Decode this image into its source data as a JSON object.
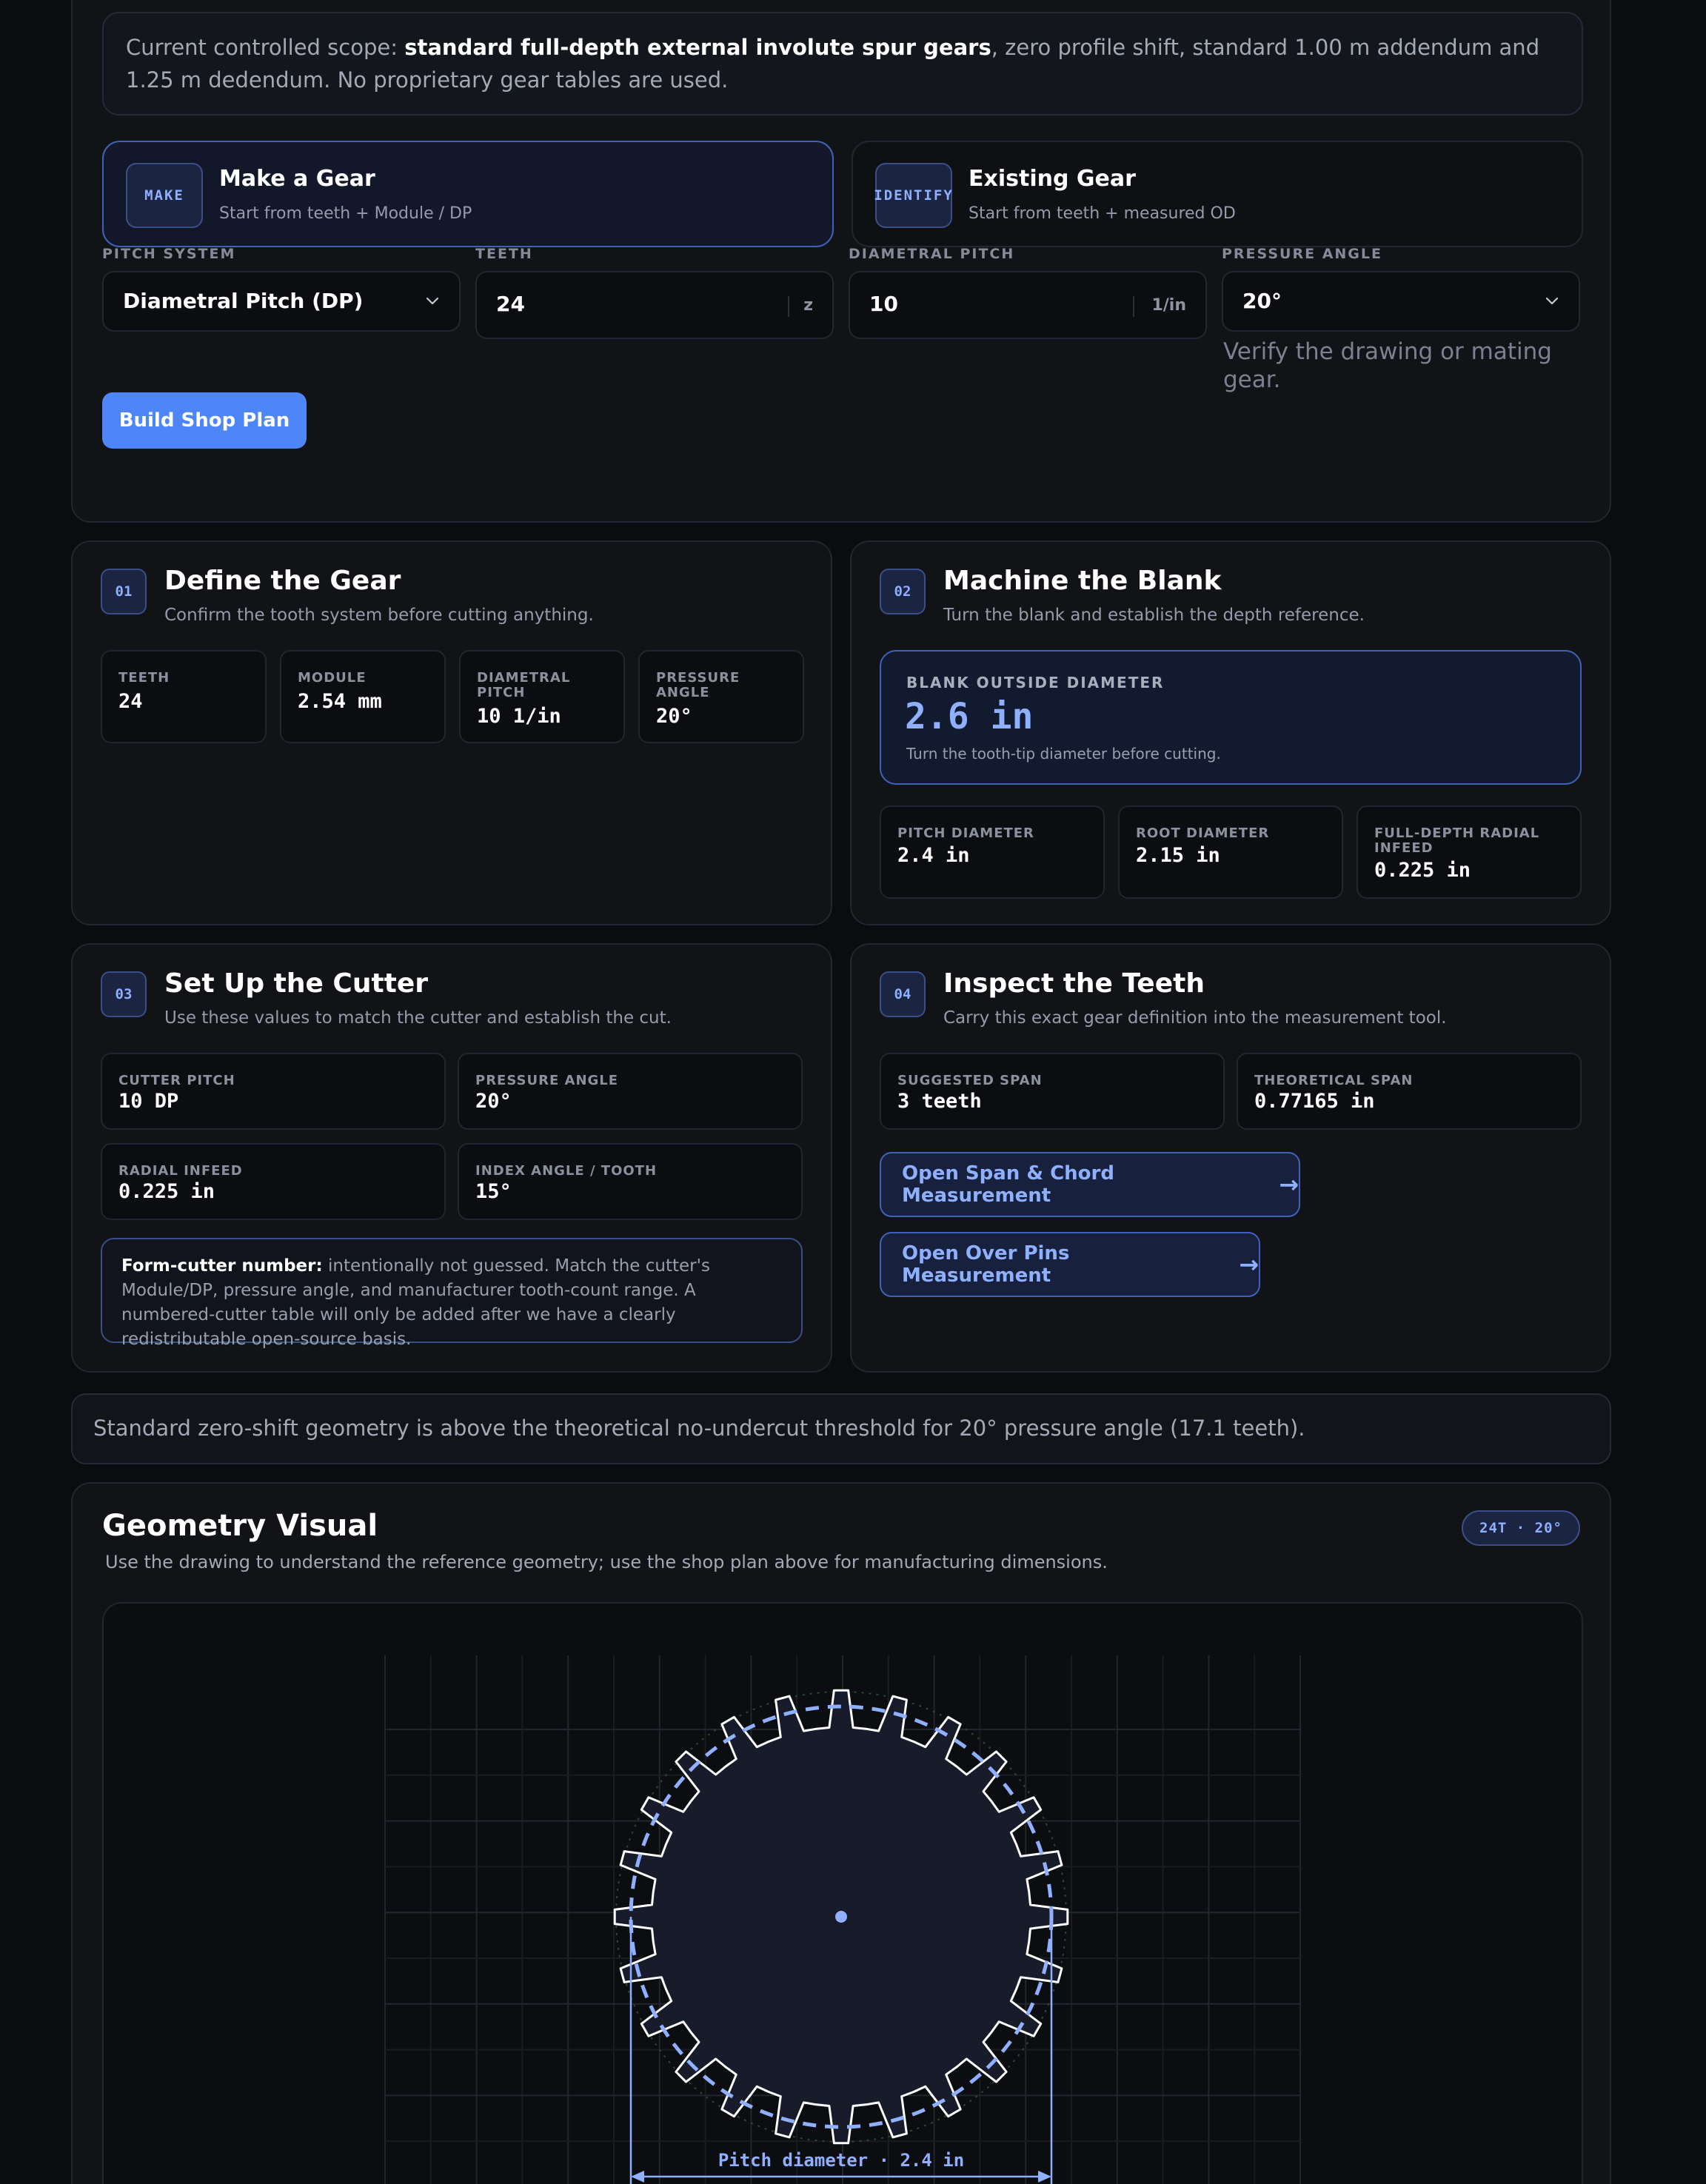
{
  "scope_note": {
    "prefix": "Current controlled scope: ",
    "bold": "standard full-depth external involute spur gears",
    "suffix": ", zero profile shift, standard 1.00 m addendum and 1.25 m dedendum. No proprietary gear tables are used."
  },
  "modes": [
    {
      "badge": "MAKE",
      "title": "Make a Gear",
      "subtitle": "Start from teeth + Module / DP",
      "active": true
    },
    {
      "badge": "IDENTIFY",
      "title": "Existing Gear",
      "subtitle": "Start from teeth + measured OD",
      "active": false
    }
  ],
  "form": {
    "pitch_system": {
      "label": "PITCH SYSTEM",
      "value": "Diametral Pitch (DP)"
    },
    "teeth": {
      "label": "TEETH",
      "value": "24",
      "unit": "z"
    },
    "diametral_pitch": {
      "label": "DIAMETRAL PITCH",
      "value": "10",
      "unit": "1/in"
    },
    "pressure_angle": {
      "label": "PRESSURE ANGLE",
      "value": "20°",
      "hint": "Verify the drawing or mating gear."
    },
    "submit_label": "Build Shop Plan"
  },
  "steps": {
    "define": {
      "num": "01",
      "title": "Define the Gear",
      "subtitle": "Confirm the tooth system before cutting anything.",
      "stats": [
        {
          "label": "TEETH",
          "value": "24"
        },
        {
          "label": "MODULE",
          "value": "2.54 mm"
        },
        {
          "label": "DIAMETRAL PITCH",
          "value": "10 1/in"
        },
        {
          "label": "PRESSURE ANGLE",
          "value": "20°"
        }
      ]
    },
    "blank": {
      "num": "02",
      "title": "Machine the Blank",
      "subtitle": "Turn the blank and establish the depth reference.",
      "od_label": "BLANK OUTSIDE DIAMETER",
      "od_value": "2.6 in",
      "od_note": "Turn the tooth-tip diameter before cutting.",
      "stats": [
        {
          "label": "PITCH DIAMETER",
          "value": "2.4 in"
        },
        {
          "label": "ROOT DIAMETER",
          "value": "2.15 in"
        },
        {
          "label": "FULL-DEPTH RADIAL INFEED",
          "value": "0.225 in"
        }
      ]
    },
    "cutter": {
      "num": "03",
      "title": "Set Up the Cutter",
      "subtitle": "Use these values to match the cutter and establish the cut.",
      "stats": [
        {
          "label": "CUTTER PITCH",
          "value": "10 DP"
        },
        {
          "label": "PRESSURE ANGLE",
          "value": "20°"
        },
        {
          "label": "RADIAL INFEED",
          "value": "0.225 in"
        },
        {
          "label": "INDEX ANGLE / TOOTH",
          "value": "15°"
        }
      ],
      "note_bold": "Form-cutter number:",
      "note_text": " intentionally not guessed. Match the cutter's Module/DP, pressure angle, and manufacturer tooth-count range. A numbered-cutter table will only be added after we have a clearly redistributable open-source basis."
    },
    "inspect": {
      "num": "04",
      "title": "Inspect the Teeth",
      "subtitle": "Carry this exact gear definition into the measurement tool.",
      "stats": [
        {
          "label": "SUGGESTED SPAN",
          "value": "3 teeth"
        },
        {
          "label": "THEORETICAL SPAN",
          "value": "0.77165 in"
        }
      ],
      "links": [
        {
          "label": "Open Span & Chord Measurement",
          "arrow": "→"
        },
        {
          "label": "Open Over Pins Measurement",
          "arrow": "→"
        }
      ]
    }
  },
  "banner": "Standard zero-shift geometry is above the theoretical no-undercut threshold for 20° pressure angle (17.1 teeth).",
  "geometry": {
    "title": "Geometry Visual",
    "subtitle": "Use the drawing to understand the reference geometry; use the shop plan above for manufacturing dimensions.",
    "badge": "24T · 20°",
    "dimension_label": "Pitch diameter · 2.4 in",
    "teeth": 24,
    "accent": "#8fb0ff"
  }
}
